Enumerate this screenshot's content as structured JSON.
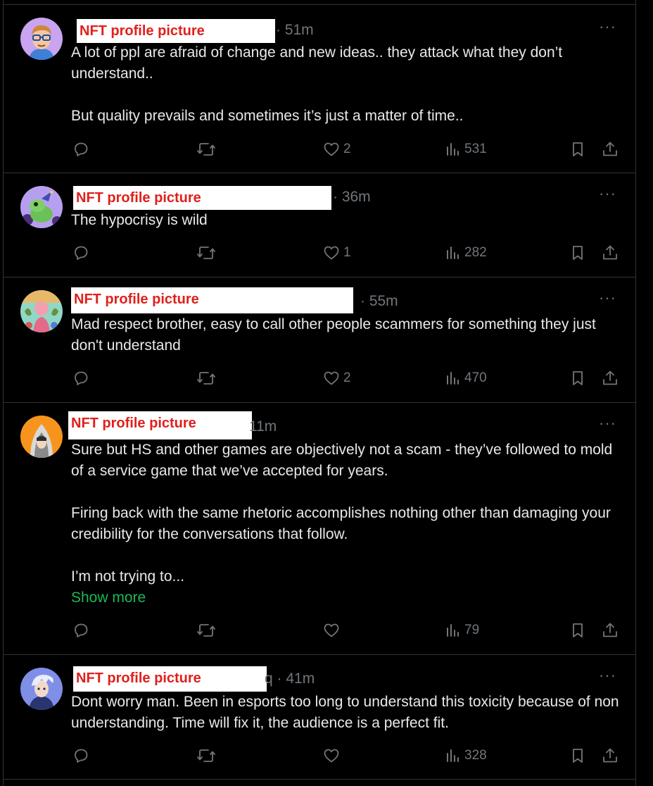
{
  "posts": [
    {
      "name_overlay": "NFT profile picture",
      "time": "· 51m",
      "paragraphs": [
        "A lot of ppl are afraid of change and new ideas.. they attack what they don’t understand..",
        "But quality prevails and sometimes it’s just a matter of time.."
      ],
      "likes": "2",
      "views": "531"
    },
    {
      "name_overlay": "NFT profile picture",
      "time": "· 36m",
      "paragraphs": [
        "The hypocrisy is wild"
      ],
      "likes": "1",
      "views": "282"
    },
    {
      "name_overlay": "NFT profile picture",
      "time": "· 55m",
      "paragraphs": [
        "Mad respect brother, easy to call other people scammers for something they just don't understand"
      ],
      "likes": "2",
      "views": "470"
    },
    {
      "name_overlay": "NFT profile picture",
      "time": "11m",
      "paragraphs": [
        "Sure but HS and other games are objectively not a scam - they’ve followed to mold of a service game that we’ve accepted for years.",
        "Firing back with the same rhetoric accomplishes nothing other than damaging your credibility for the conversations that follow.",
        "I’m not trying to..."
      ],
      "show_more": "Show more",
      "likes": "",
      "views": "79"
    },
    {
      "name_overlay": "NFT profile picture",
      "time": "q · 41m",
      "paragraphs": [
        "Dont worry man. Been in esports too long to understand this toxicity because of non understanding. Time will fix it, the audience is a perfect fit."
      ],
      "likes": "",
      "views": "328"
    }
  ],
  "more_glyph": "···",
  "icons": {
    "reply": "reply-icon",
    "repost": "repost-icon",
    "like": "heart-icon",
    "views": "views-icon",
    "bookmark": "bookmark-icon",
    "share": "share-icon",
    "more": "more-icon"
  },
  "colors": {
    "background": "#000000",
    "text": "#e7e9ea",
    "muted": "#71767b",
    "divider": "#2f3336",
    "overlay_text": "#e0201c",
    "show_more": "#1db954"
  }
}
